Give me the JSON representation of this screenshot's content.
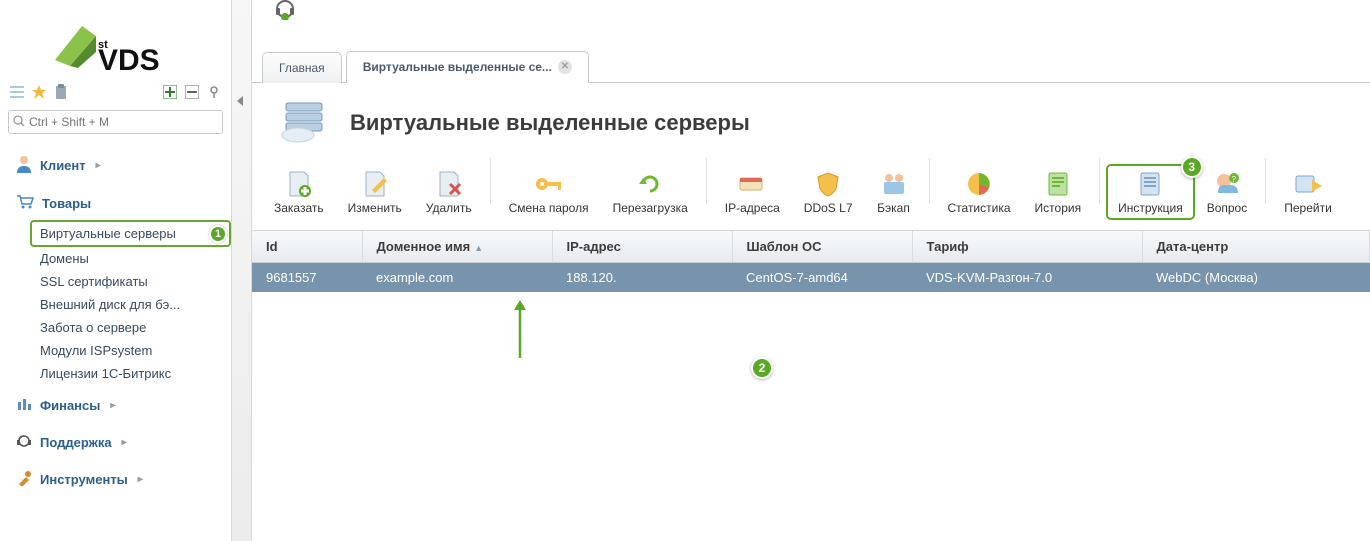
{
  "sidebar": {
    "search_placeholder": "Ctrl + Shift + M",
    "sections": [
      {
        "label": "Клиент",
        "icon": "person-icon"
      },
      {
        "label": "Товары",
        "icon": "cart-icon",
        "items": [
          {
            "label": "Виртуальные серверы",
            "active": true
          },
          {
            "label": "Домены"
          },
          {
            "label": "SSL сертификаты"
          },
          {
            "label": "Внешний диск для бэ..."
          },
          {
            "label": "Забота о сервере"
          },
          {
            "label": "Модули ISPsystem"
          },
          {
            "label": "Лицензии 1С-Битрикс"
          }
        ]
      },
      {
        "label": "Финансы",
        "icon": "finance-icon"
      },
      {
        "label": "Поддержка",
        "icon": "support-icon"
      },
      {
        "label": "Инструменты",
        "icon": "tools-icon"
      }
    ]
  },
  "tabs": [
    {
      "label": "Главная",
      "closable": false
    },
    {
      "label": "Виртуальные выделенные се...",
      "closable": true,
      "active": true
    }
  ],
  "page_title": "Виртуальные выделенные серверы",
  "toolbar": [
    {
      "label": "Заказать"
    },
    {
      "label": "Изменить"
    },
    {
      "label": "Удалить"
    },
    {
      "sep": true
    },
    {
      "label": "Смена пароля"
    },
    {
      "label": "Перезагрузка"
    },
    {
      "sep": true
    },
    {
      "label": "IP-адреса"
    },
    {
      "label": "DDoS L7"
    },
    {
      "label": "Бэкап"
    },
    {
      "sep": true
    },
    {
      "label": "Статистика"
    },
    {
      "label": "История"
    },
    {
      "sep": true
    },
    {
      "label": "Инструкция",
      "highlight": true
    },
    {
      "label": "Вопрос"
    },
    {
      "sep": true
    },
    {
      "label": "Перейти"
    }
  ],
  "table": {
    "columns": [
      {
        "label": "Id"
      },
      {
        "label": "Доменное имя",
        "sorted": true
      },
      {
        "label": "IP-адрес"
      },
      {
        "label": "Шаблон ОС"
      },
      {
        "label": "Тариф"
      },
      {
        "label": "Дата-центр"
      }
    ],
    "rows": [
      {
        "id": "9681557",
        "domain": "example.com",
        "ip": "188.120.",
        "os": "CentOS-7-amd64",
        "tariff": "VDS-KVM-Разгон-7.0",
        "dc": "WebDC (Москва)"
      }
    ]
  },
  "callouts": {
    "c1": "1",
    "c2": "2",
    "c3": "3"
  }
}
